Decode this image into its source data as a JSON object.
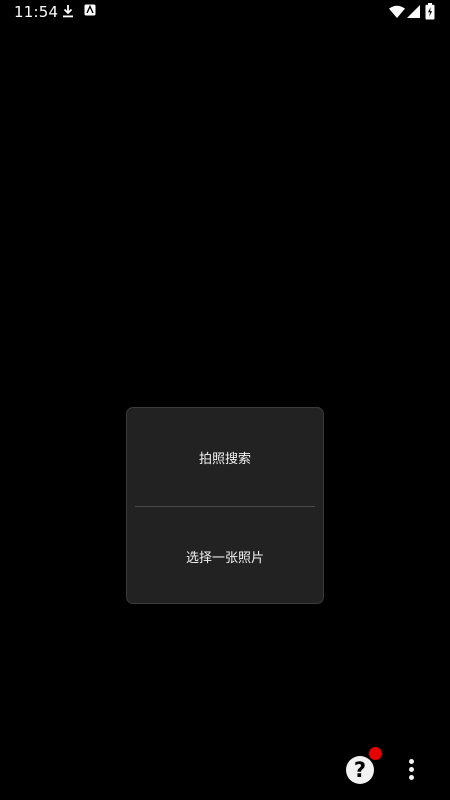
{
  "status_bar": {
    "time": "11:54",
    "left_icons": [
      "download-icon",
      "app-notification-icon"
    ],
    "right_icons": [
      "wifi-icon",
      "signal-icon",
      "battery-charging-icon"
    ]
  },
  "dialog": {
    "option_photo_search": "拍照搜索",
    "option_select_photo": "选择一张照片"
  },
  "toolbar": {
    "help_icon": "question-mark-icon",
    "help_glyph": "?",
    "has_notification": true,
    "more_icon": "more-vertical-icon"
  },
  "colors": {
    "background": "#000000",
    "dialog_bg": "#222222",
    "divider": "#4a4a4a",
    "notification": "#e60000",
    "text": "#f2f2f2"
  }
}
